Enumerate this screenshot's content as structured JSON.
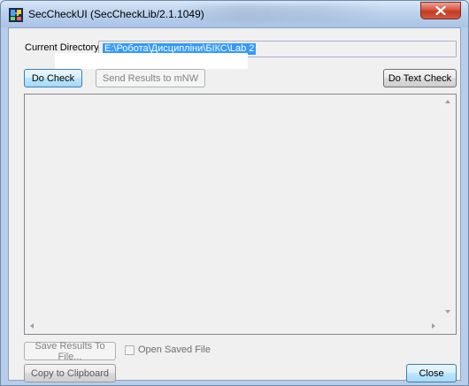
{
  "window": {
    "title": "SecCheckUI (SecCheckLib/2.1.1049)"
  },
  "directory": {
    "label": "Current Directory:",
    "value": "E:\\Робота\\Дисципліни\\БІКС\\Lab 2"
  },
  "buttons": {
    "do_check": "Do Check",
    "send_results": "Send Results to mNW",
    "do_text_check": "Do Text Check",
    "save_results": "Save Results To File...",
    "copy_clipboard": "Copy to Clipboard",
    "close": "Close"
  },
  "options": {
    "open_saved_file": "Open Saved File"
  },
  "icons": {
    "app": "puzzle-app-icon",
    "close": "close-icon",
    "scroll_up": "arrow-up-icon",
    "scroll_down": "arrow-down-icon",
    "scroll_left": "arrow-left-icon",
    "scroll_right": "arrow-right-icon"
  },
  "colors": {
    "selection": "#3399ff",
    "close_red": "#c23a22",
    "focus_border": "#3c7fb1"
  }
}
